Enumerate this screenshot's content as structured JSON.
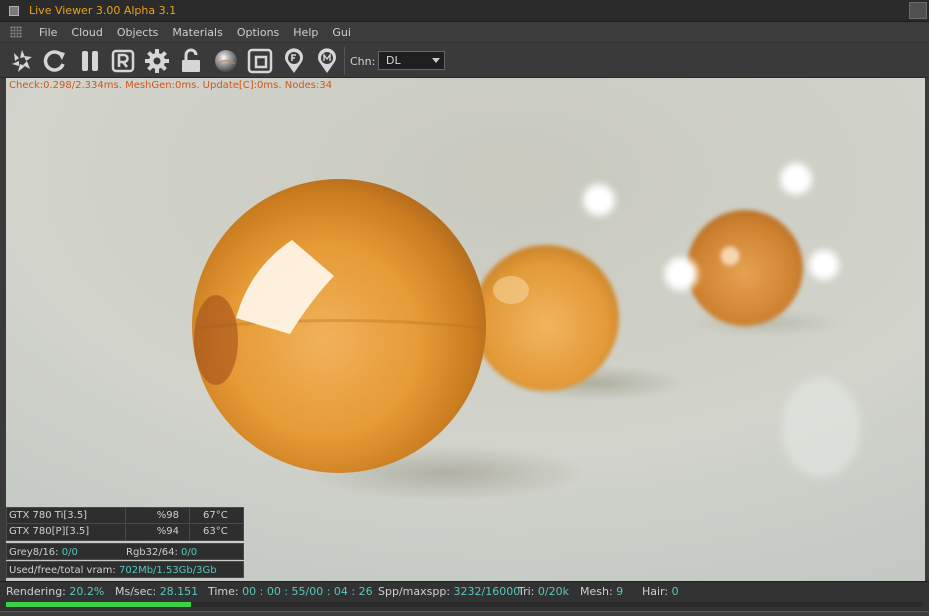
{
  "window": {
    "title": "Live Viewer 3.00 Alpha 3.1"
  },
  "menu": {
    "items": [
      "File",
      "Cloud",
      "Objects",
      "Materials",
      "Options",
      "Help",
      "Gui"
    ]
  },
  "toolbar": {
    "buttons": [
      "render-settings",
      "restart",
      "pause",
      "region-render",
      "settings",
      "lock",
      "material-preview",
      "viewport-frame",
      "focus-pick",
      "material-pick"
    ],
    "channel_label": "Chn:",
    "channel_value": "DL"
  },
  "viewport": {
    "stats_line": "Check:0.298/2.334ms. MeshGen:0ms. Update[C]:0ms. Nodes:34"
  },
  "gpus": [
    {
      "name": "GTX 780 Ti[3.5]",
      "usage": "%98",
      "temp": "67°C"
    },
    {
      "name": "GTX 780[P][3.5]",
      "usage": "%94",
      "temp": "63°C"
    }
  ],
  "memory": {
    "grey_label": "Grey8/16:",
    "grey_value": "0/0",
    "rgb_label": "Rgb32/64:",
    "rgb_value": "0/0",
    "vram_label": "Used/free/total vram:",
    "vram_value": "702Mb/1.53Gb/3Gb"
  },
  "status": {
    "rendering_label": "Rendering:",
    "rendering_value": "20.2%",
    "ms_label": "Ms/sec:",
    "ms_value": "28.151",
    "time_label": "Time:",
    "time_value": "00 : 00 : 55/00 : 04 : 26",
    "spp_label": "Spp/maxspp:",
    "spp_value": "3232/16000",
    "tri_label": "Tri:",
    "tri_value": "0/20k",
    "mesh_label": "Mesh:",
    "mesh_value": "9",
    "hair_label": "Hair:",
    "hair_value": "0",
    "progress": 0.202
  },
  "colors": {
    "title": "#e9a21b",
    "stats": "#d2551b",
    "value": "#55c8c0",
    "progress": "#3ad04a"
  }
}
